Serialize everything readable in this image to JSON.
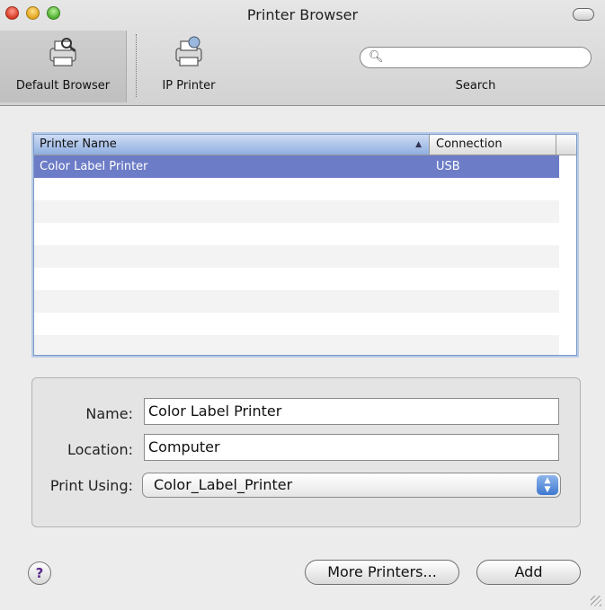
{
  "window": {
    "title": "Printer Browser"
  },
  "toolbar": {
    "default_browser_label": "Default Browser",
    "ip_printer_label": "IP Printer",
    "search_label": "Search",
    "search_placeholder": ""
  },
  "printer_list": {
    "headers": {
      "name": "Printer Name",
      "connection": "Connection"
    },
    "rows": [
      {
        "name": "Color Label Printer",
        "connection": "USB",
        "selected": true
      }
    ]
  },
  "details": {
    "name_label": "Name:",
    "name_value": "Color Label Printer",
    "location_label": "Location:",
    "location_value": "Computer",
    "print_using_label": "Print Using:",
    "print_using_value": "Color_Label_Printer"
  },
  "buttons": {
    "more_printers": "More Printers...",
    "add": "Add",
    "help": "?"
  },
  "colors": {
    "selection": "#6c7cc7",
    "list_border": "#7a9ac8"
  }
}
